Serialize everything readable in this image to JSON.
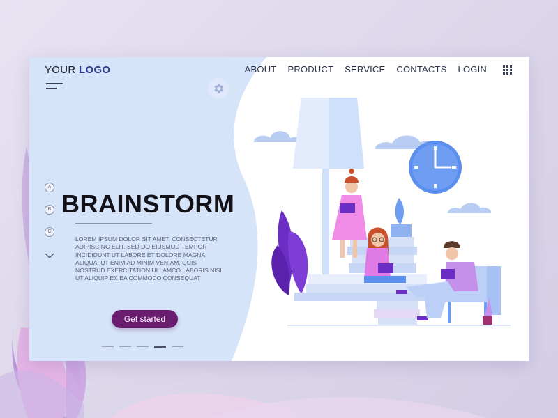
{
  "brand": {
    "prefix": "YOUR",
    "name": "LOGO"
  },
  "nav": {
    "items": [
      "ABOUT",
      "PRODUCT",
      "SERVICE",
      "CONTACTS",
      "LOGIN"
    ]
  },
  "side_nav": {
    "items": [
      "A",
      "B",
      "C"
    ]
  },
  "hero": {
    "title": "BRAINSTORM",
    "body": "LOREM IPSUM DOLOR SIT AMET, CONSECTETUR ADIPISCING ELIT, SED DO EIUSMOD TEMPOR INCIDIDUNT UT LABORE ET DOLORE MAGNA ALIQUA. UT ENIM AD MINIM VENIAM, QUIS NOSTRUD EXERCITATION ULLAMCO LABORIS NISI UT ALIQUIP EX EA COMMODO CONSEQUAT",
    "cta_label": "Get started"
  },
  "pager": {
    "count": 5,
    "active_index": 3
  },
  "colors": {
    "panel_blue": "#d6e4fa",
    "accent_purple": "#6a1c6f",
    "logo_blue": "#2d3c8c",
    "clock_blue": "#5a8ff0"
  },
  "icons": {
    "menu": "hamburger-icon",
    "settings": "gear-icon",
    "apps": "grid-icon",
    "scroll": "chevron-down-icon"
  }
}
